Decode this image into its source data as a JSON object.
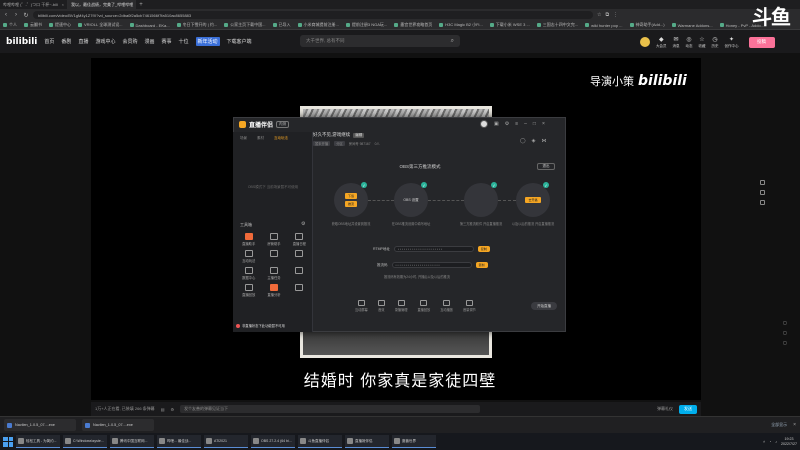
{
  "browser": {
    "tabs": [
      {
        "title": "哔哩哔哩 (゜-゜)つロ 干杯~-bili",
        "active": false
      },
      {
        "title": "我以，最佳战绩，完美了_哔哩哔哩",
        "active": true
      }
    ],
    "url": "bilibili.com/video/BV1gM4y1Z7fX?vd_source=2dba0f2a5cb7461566f7fa510ac8655883",
    "bookmarks": [
      "个人",
      "云翻书",
      "提速中心",
      "VRIOLL 全球测试设...",
      "Dashboard - EKa...",
      "冬日下雪开的 | 约...",
      "公家主页下载中国...",
      "已导入",
      "小米商城提前注册...",
      "提前注册3 NGA玩...",
      "墨宫世界攻略首页",
      "H3C Magic B2 小Fi...",
      "下载小米 WSE 3 ...",
      "三国志十四中文完...",
      "wiki hunter pop ...",
      "神奇助手(Add...)",
      "Warmane Addons...",
      "Honey - PvP - Addo..."
    ],
    "newtab": "+"
  },
  "overlay_logo": "斗鱼",
  "bili": {
    "logo": "bilibili",
    "nav": [
      "首页",
      "番剧",
      "直播",
      "游戏中心",
      "会员购",
      "漫画",
      "赛事",
      "十位",
      "新年活动",
      "下载客户端"
    ],
    "nav_badge_index": 8,
    "search_placeholder": "大千世界, 总有不同",
    "right_items": [
      "大会员",
      "消息",
      "动态",
      "收藏",
      "历史",
      "创作中心"
    ],
    "upload": "投稿"
  },
  "video": {
    "watermark_text": "导演小策",
    "watermark_bili": "bilibili",
    "subtitle": "结婚时 你家真是家徒四壁"
  },
  "app": {
    "name": "直播伴侣",
    "version": "内测",
    "left_tabs": [
      "场景",
      "素材",
      "互动玩法"
    ],
    "left_empty": "OBS模式下 当前场景暂不可使用",
    "tools_label": "工具箱",
    "tools": [
      "直播助手",
      "房管助手",
      "直播日程",
      "互动玩法",
      "",
      "",
      "数据中心",
      "主播任务",
      "",
      "直播回放",
      "直播分析",
      ""
    ],
    "warn": "非直播状态下此功能暂不可用",
    "stream_title": "好久不见,游戏继续",
    "stream_tag": "编辑",
    "stream_meta": [
      "暂未开播",
      "分区",
      "房间号 987167",
      "0人"
    ],
    "mode_title": "OBS第三方推流模式",
    "close": "退出",
    "steps": [
      {
        "label": "OBS推流",
        "chips": [
          "下载",
          "推流"
        ],
        "caption": "获取OBS地址并设置到推流"
      },
      {
        "label": "OBS 设置",
        "chips": [],
        "caption": "在OBS推流设置中填写地址"
      },
      {
        "label": "",
        "chips": [],
        "caption": "第三方推流软件 开启直播推流"
      },
      {
        "label": "",
        "chips": [
          "去开播"
        ],
        "caption": "以及以后的推流 开启直播推流"
      }
    ],
    "fields": [
      {
        "label": "RTMP地址",
        "value": "••••••••••••••••••••••",
        "btn": "复制"
      },
      {
        "label": "推流码",
        "value": "••••••••••••••••••••••",
        "btn": "复制"
      }
    ],
    "field_note": "推流码有效期为24小时, 开播后以及以后的推流",
    "toolbar": [
      "互动屏幕",
      "音效",
      "录播管理",
      "直播回放",
      "互动播放",
      "音量调节"
    ],
    "live_btn": "开始直播"
  },
  "danmaku": {
    "count_text": "1万+人正在看, 已装填 266 条弹幕",
    "placeholder": "发个友善的弹幕见证当下",
    "etiquette": "弹幕礼仪",
    "send": "发送"
  },
  "downloads": [
    "Navilen_1.0.5_07....exe",
    "Navilen_1.0.5_07....exe"
  ],
  "downloads_all": "全部显示",
  "taskbar": {
    "apps": [
      "轻松工具 - 为简约...",
      "C:\\Windows\\syste...",
      "腾讯中国互联网...",
      "哔哩... 最佳战...",
      "ATI2021",
      "OBS 27.2.4 (64 bi...",
      "斗鱼直播伴侣",
      "直播姬伴侣",
      "魔兽世界"
    ],
    "time": "19:23",
    "date": "2022/7/27"
  }
}
